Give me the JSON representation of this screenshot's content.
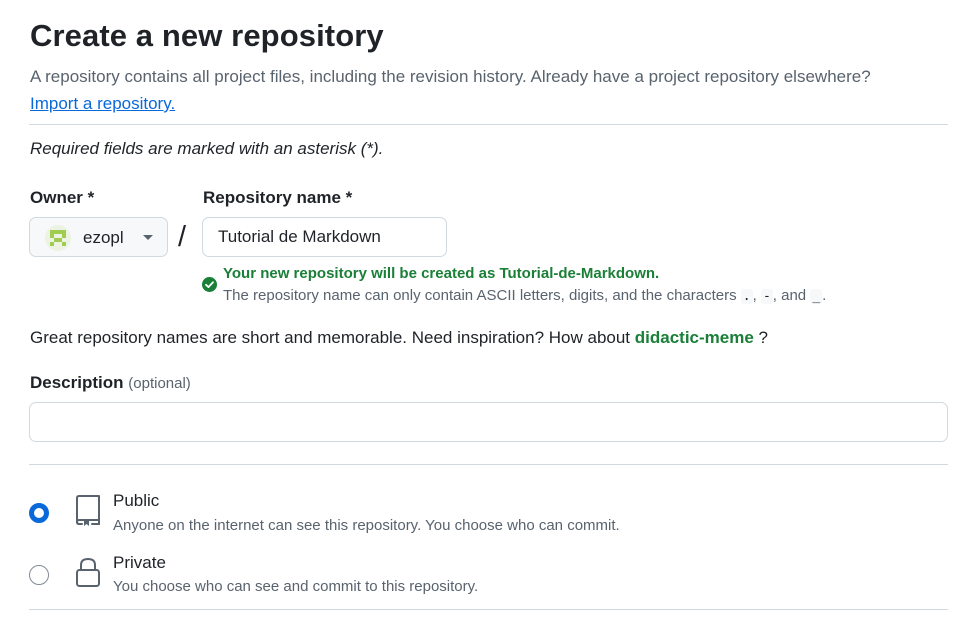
{
  "header": {
    "title": "Create a new repository",
    "subtitle": "A repository contains all project files, including the revision history. Already have a project repository elsewhere?",
    "import_link": "Import a repository."
  },
  "form": {
    "required_note": "Required fields are marked with an asterisk (*).",
    "owner": {
      "label": "Owner *",
      "value": "ezopl",
      "icon": "chevron-down-icon"
    },
    "slash": "/",
    "repo_name": {
      "label": "Repository name *",
      "value": "Tutorial de Markdown"
    },
    "validation": {
      "success": "Your new repository will be created as Tutorial-de-Markdown.",
      "help_prefix": "The repository name can only contain ASCII letters, digits, and the characters",
      "char_dot": ".",
      "comma1": ",",
      "char_dash": "-",
      "comma_and": ", and",
      "char_underscore": "_",
      "period": "."
    },
    "suggestion": {
      "text": "Great repository names are short and memorable. Need inspiration? How about",
      "name": "didactic-meme",
      "suffix": "?"
    },
    "description": {
      "label": "Description",
      "optional": "(optional)",
      "value": "",
      "placeholder": ""
    },
    "visibility": [
      {
        "title": "Public",
        "desc": "Anyone on the internet can see this repository. You choose who can commit.",
        "icon": "repo-book-icon",
        "checked": true
      },
      {
        "title": "Private",
        "desc": "You choose who can see and commit to this repository.",
        "icon": "lock-icon",
        "checked": false
      }
    ]
  },
  "colors": {
    "text": "#1f2328",
    "muted": "#59636e",
    "link": "#0969da",
    "success": "#1a7f37",
    "border": "#d1d9e0",
    "radio_selected": "#0969da"
  }
}
